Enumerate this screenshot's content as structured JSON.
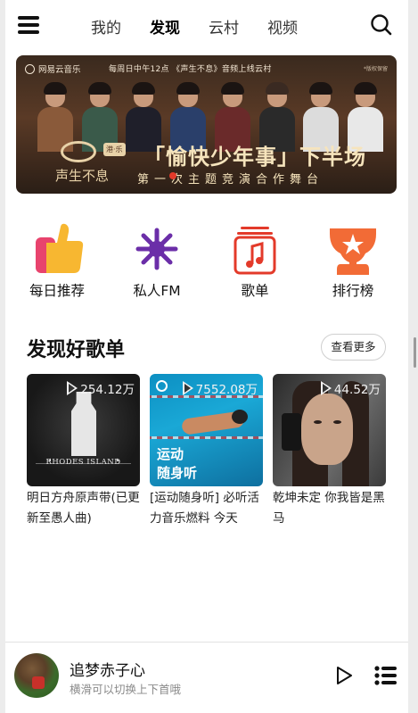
{
  "topbar": {
    "tabs": [
      {
        "label": "我的",
        "active": false
      },
      {
        "label": "发现",
        "active": true
      },
      {
        "label": "云村",
        "active": false
      },
      {
        "label": "视频",
        "active": false
      }
    ],
    "menu_icon": "hamburger-menu-icon",
    "search_icon": "search-icon"
  },
  "banner": {
    "logo_text": "网易云音乐",
    "top_text": "每周日中午12点 《声生不息》音频上线云村",
    "corner_text": "*版权保留",
    "brand": "声生不息",
    "tag": "港·乐",
    "title": "「愉快少年事」下半场",
    "subtitle": "第一次主题竞演合作舞台"
  },
  "quick_entries": [
    {
      "label": "每日推荐",
      "icon": "thumbs-up-icon"
    },
    {
      "label": "私人FM",
      "icon": "fm-radio-icon"
    },
    {
      "label": "歌单",
      "icon": "music-note-icon"
    },
    {
      "label": "排行榜",
      "icon": "trophy-icon"
    }
  ],
  "section": {
    "title": "发现好歌单",
    "more_label": "查看更多"
  },
  "playlists": [
    {
      "play_count": "254.12万",
      "name": "明日方舟原声带(已更新至愚人曲)",
      "cover_text": "RHODES ISLAND"
    },
    {
      "play_count": "7552.08万",
      "name": "[运动随身听] 必听活力音乐燃料 今天",
      "cover_text_1": "运动",
      "cover_text_2": "随身听"
    },
    {
      "play_count": "44.52万",
      "name": "乾坤未定 你我皆是黑马"
    }
  ],
  "player": {
    "song_title": "追梦赤子心",
    "hint": "横滑可以切换上下首哦",
    "play_icon": "play-icon",
    "playlist_icon": "playlist-icon"
  },
  "colors": {
    "accent_red": "#e33a2a",
    "fm_purple": "#6b2ea8",
    "trophy_orange": "#f26b36",
    "thumb_yellow": "#f7b731",
    "thumb_pink": "#e8436d"
  }
}
